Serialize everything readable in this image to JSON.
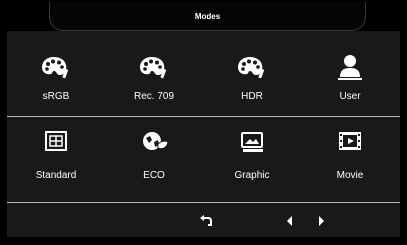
{
  "header": {
    "title": "Modes"
  },
  "modes_row1": [
    {
      "label": "sRGB",
      "icon": "palette-icon"
    },
    {
      "label": "Rec. 709",
      "icon": "palette-icon"
    },
    {
      "label": "HDR",
      "icon": "palette-icon"
    },
    {
      "label": "User",
      "icon": "user-icon"
    }
  ],
  "modes_row2": [
    {
      "label": "Standard",
      "icon": "standard-icon"
    },
    {
      "label": "ECO",
      "icon": "eco-icon"
    },
    {
      "label": "Graphic",
      "icon": "graphic-icon"
    },
    {
      "label": "Movie",
      "icon": "movie-icon"
    }
  ],
  "nav": {
    "back_icon": "return-icon",
    "prev_icon": "left-arrow-icon",
    "next_icon": "right-arrow-icon"
  },
  "colors": {
    "background": "#000000",
    "panel": "#191919",
    "separator": "#b5b5b5",
    "text": "#ffffff"
  }
}
